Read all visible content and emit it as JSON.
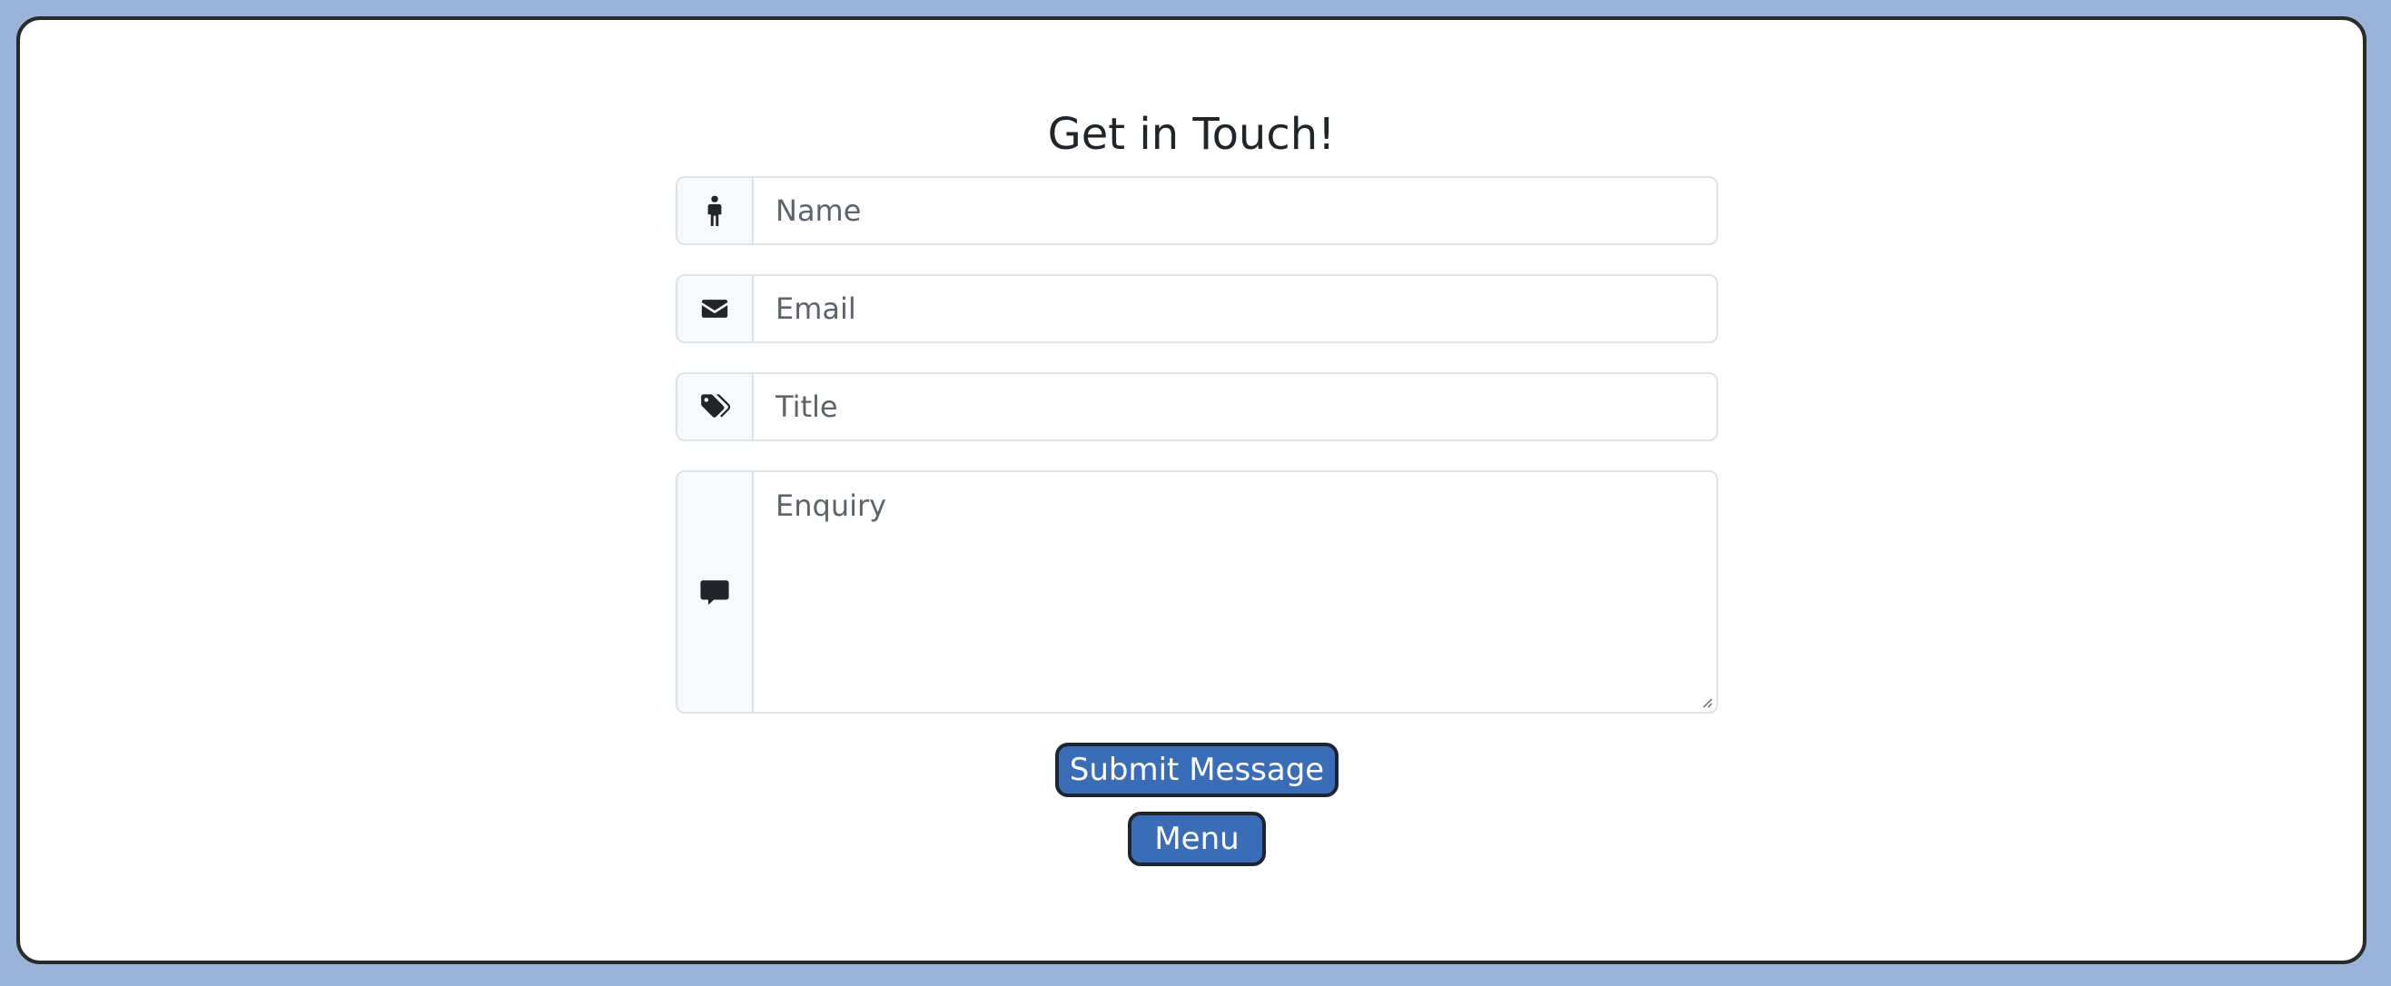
{
  "heading": "Get in Touch!",
  "form": {
    "name_placeholder": "Name",
    "email_placeholder": "Email",
    "title_placeholder": "Title",
    "enquiry_placeholder": "Enquiry"
  },
  "icons": {
    "name": "person-icon",
    "email": "envelope-icon",
    "title": "tags-icon",
    "enquiry": "chat-bubble-icon"
  },
  "buttons": {
    "submit_label": "Submit Message",
    "menu_label": "Menu"
  },
  "colors": {
    "page_background": "#9bb3d9",
    "button_background": "#3b6db7"
  }
}
